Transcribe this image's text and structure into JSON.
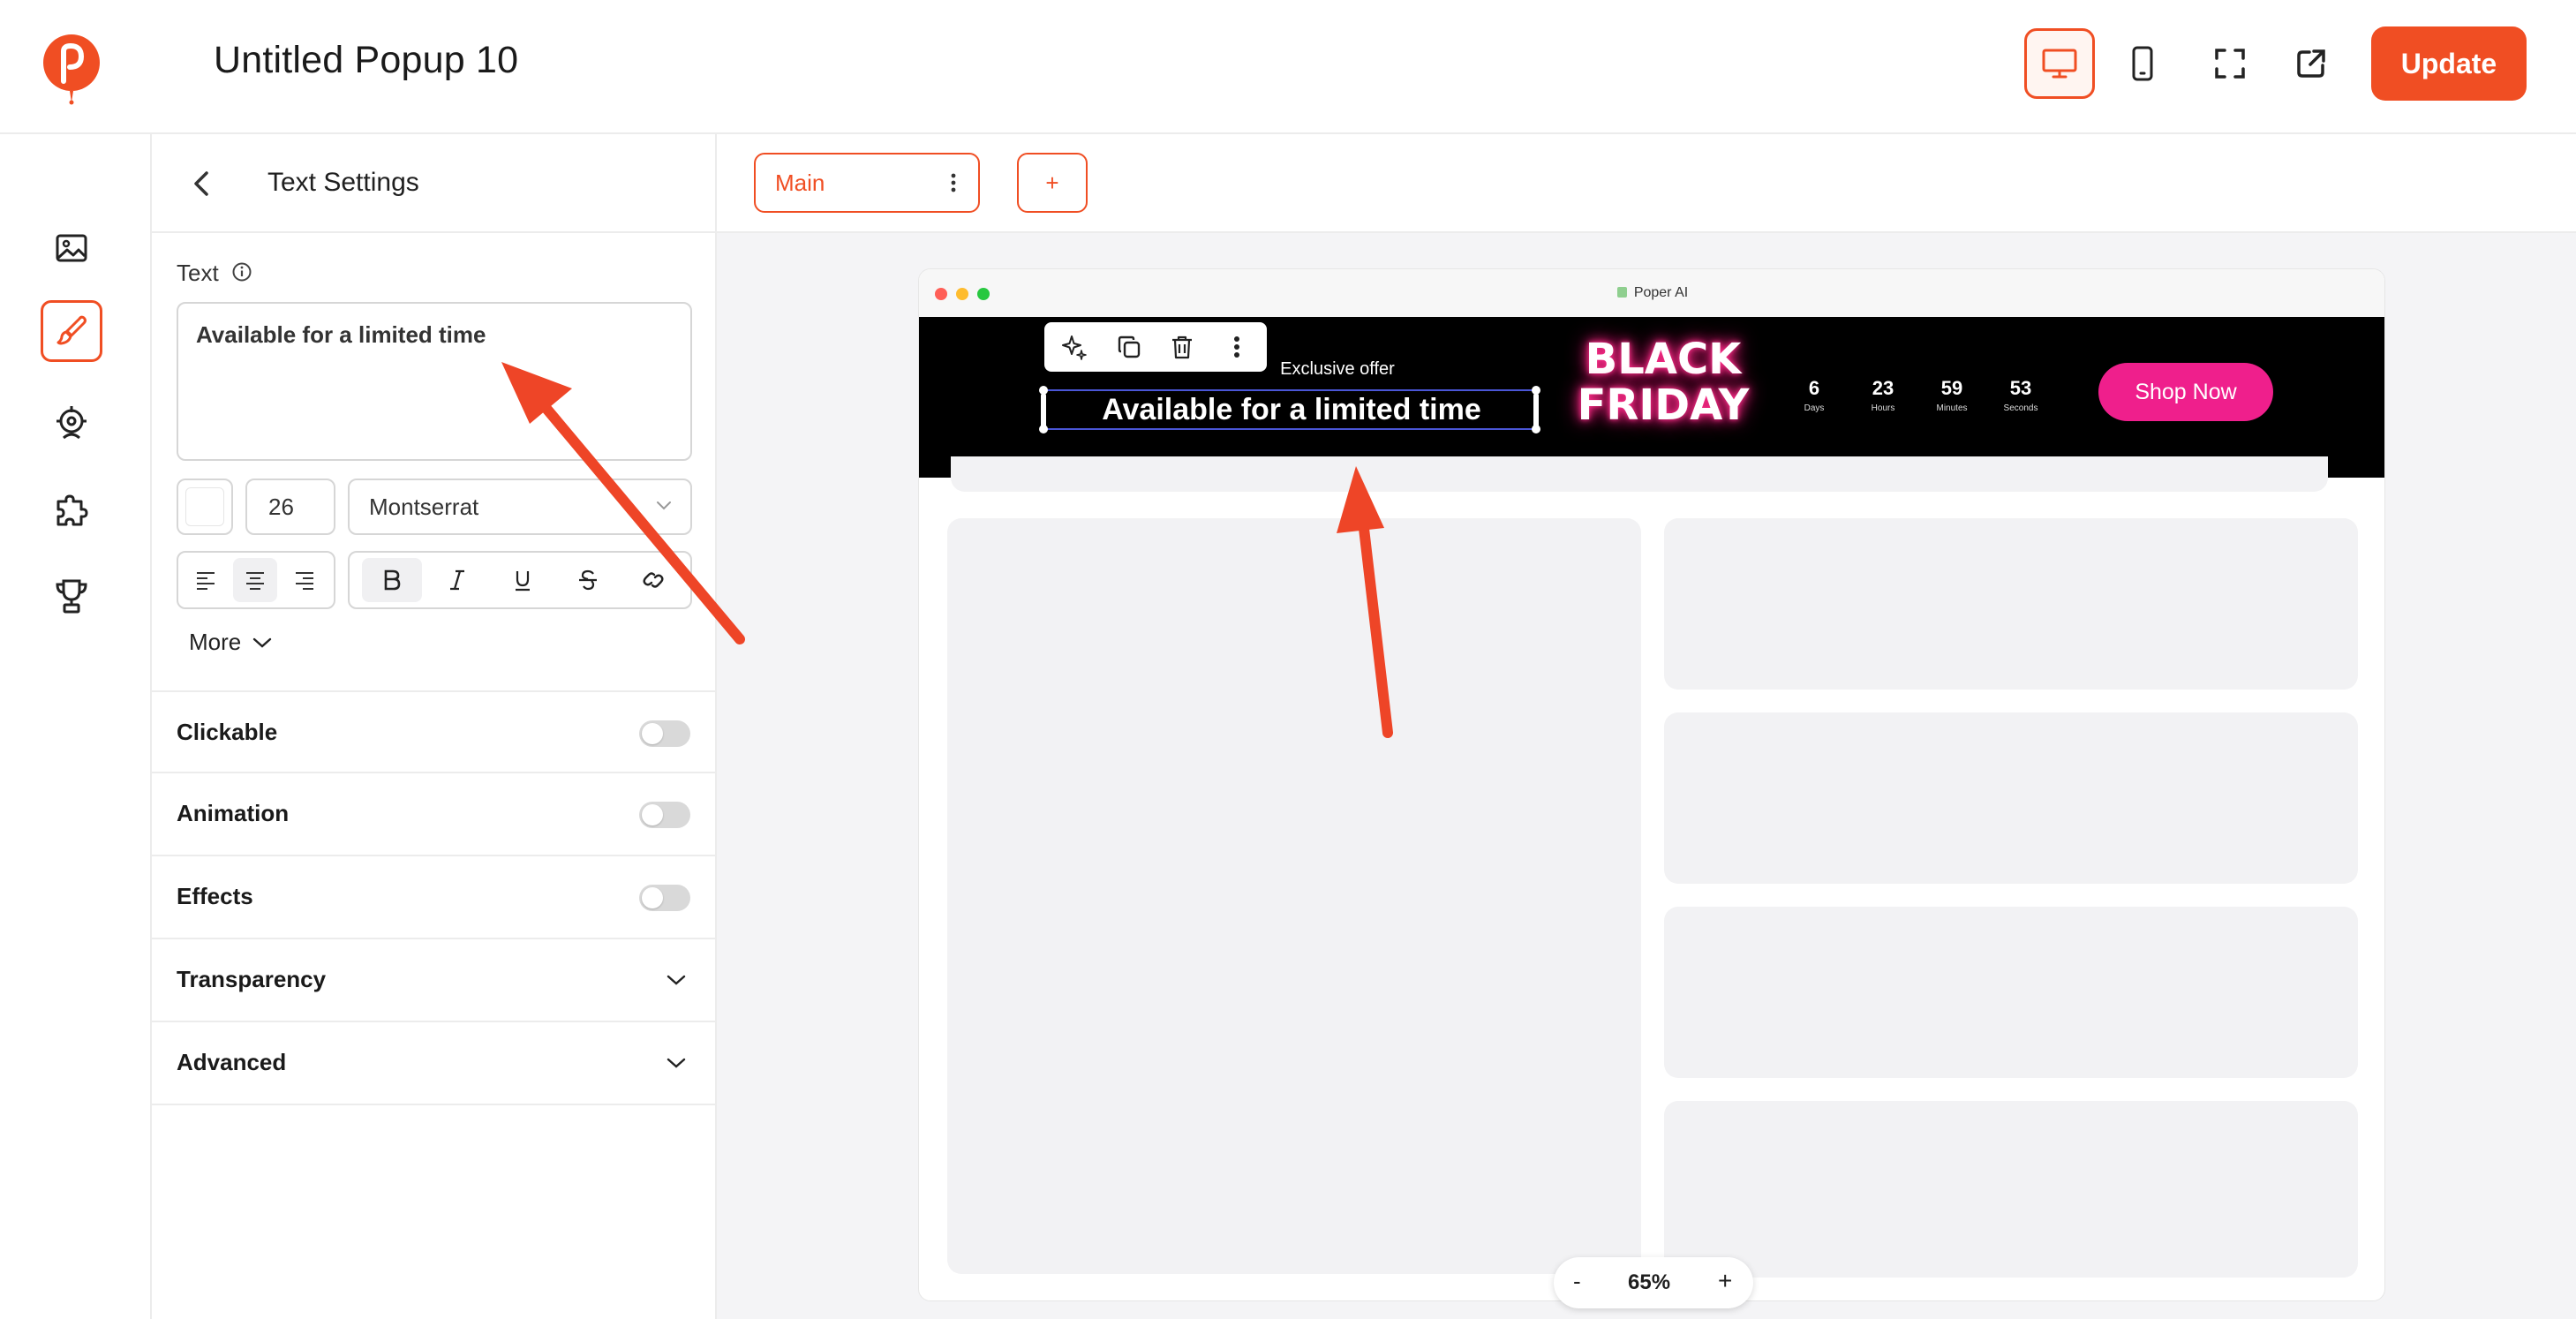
{
  "header": {
    "title": "Untitled Popup 10",
    "update_label": "Update",
    "icons": [
      "logo-icon",
      "desktop-icon",
      "mobile-icon",
      "fullscreen-icon",
      "external-link-icon"
    ]
  },
  "rail": {
    "items": [
      "image-icon",
      "brush-icon",
      "target-icon",
      "puzzle-icon",
      "trophy-icon"
    ],
    "active": "brush-icon"
  },
  "panel": {
    "title": "Text Settings",
    "text_label": "Text",
    "text_value": "Available for a limited time",
    "font_size": "26",
    "font_family": "Montserrat",
    "more_label": "More",
    "sections": {
      "clickable": "Clickable",
      "animation": "Animation",
      "effects": "Effects",
      "transparency": "Transparency",
      "advanced": "Advanced"
    }
  },
  "canvas": {
    "tab_main": "Main",
    "tab_add": "+",
    "browser_title": "Poper AI",
    "banner": {
      "eyebrow": "Exclusive offer",
      "headline": "Available for a limited time",
      "black_friday_line1": "BLACK",
      "black_friday_line2": "FRIDAY",
      "countdown": [
        {
          "value": "6",
          "label": "Days"
        },
        {
          "value": "23",
          "label": "Hours"
        },
        {
          "value": "59",
          "label": "Minutes"
        },
        {
          "value": "53",
          "label": "Seconds"
        }
      ],
      "cta": "Shop Now"
    },
    "zoom": {
      "minus": "-",
      "value": "65%",
      "plus": "+"
    }
  },
  "colors": {
    "accent": "#f04e23",
    "cta_pink": "#ef1f8c",
    "annotation_arrow": "#ee4527"
  }
}
